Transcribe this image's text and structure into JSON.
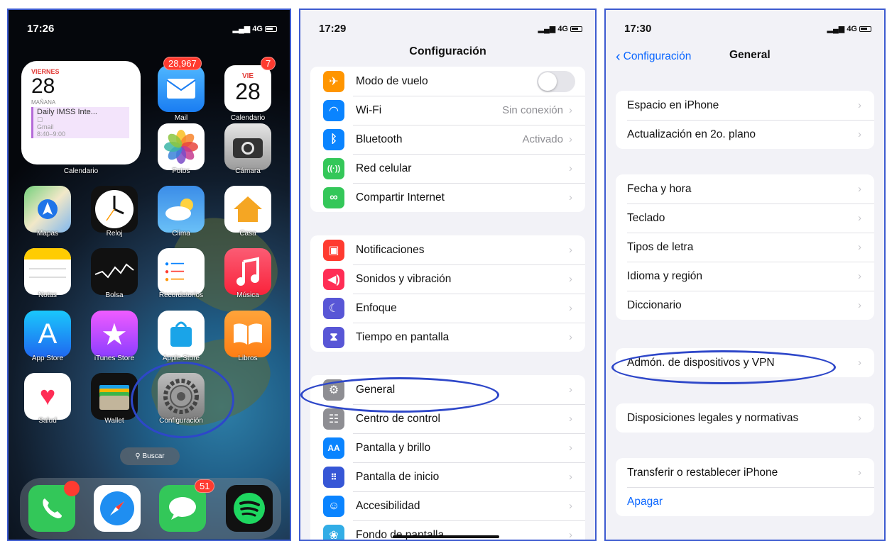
{
  "home": {
    "time": "17:26",
    "signal": "4G",
    "widget": {
      "weekday": "VIERNES",
      "day": "28",
      "tomorrow": "MAÑANA",
      "event_title": "Daily IMSS Inte...",
      "event_source": "Gmail",
      "event_time": "8:40–9:00",
      "label": "Calendario"
    },
    "apps": [
      {
        "label": "Mail",
        "badge": "28,967",
        "icon": "mail-icon"
      },
      {
        "label": "Calendario",
        "weekday": "VIE",
        "day": "28",
        "badge": "7",
        "icon": "calendar-icon"
      },
      {
        "label": "Fotos",
        "icon": "photos-icon"
      },
      {
        "label": "Cámara",
        "icon": "camera-icon"
      },
      {
        "label": "Mapas",
        "icon": "maps-icon"
      },
      {
        "label": "Reloj",
        "icon": "clock-icon"
      },
      {
        "label": "Clima",
        "icon": "weather-icon"
      },
      {
        "label": "Casa",
        "icon": "home-icon"
      },
      {
        "label": "Notas",
        "icon": "notes-icon"
      },
      {
        "label": "Bolsa",
        "icon": "stocks-icon"
      },
      {
        "label": "Recordatorios",
        "icon": "reminders-icon"
      },
      {
        "label": "Música",
        "icon": "music-icon"
      },
      {
        "label": "App Store",
        "icon": "app-store-icon"
      },
      {
        "label": "iTunes Store",
        "icon": "itunes-icon"
      },
      {
        "label": "Apple Store",
        "icon": "apple-store-icon"
      },
      {
        "label": "Libros",
        "icon": "books-icon"
      },
      {
        "label": "Salud",
        "icon": "health-icon"
      },
      {
        "label": "Wallet",
        "icon": "wallet-icon"
      },
      {
        "label": "Configuración",
        "icon": "settings-gear-icon"
      }
    ],
    "search_label": "Buscar",
    "dock_badge_messages": "51"
  },
  "settings": {
    "time": "17:29",
    "signal": "4G",
    "title": "Configuración",
    "groups": [
      [
        {
          "label": "Modo de vuelo",
          "color": "#ff9500",
          "toggle": true
        },
        {
          "label": "Wi-Fi",
          "value": "Sin conexión",
          "color": "#0a84ff"
        },
        {
          "label": "Bluetooth",
          "value": "Activado",
          "color": "#0a84ff"
        },
        {
          "label": "Red celular",
          "color": "#34c759"
        },
        {
          "label": "Compartir Internet",
          "color": "#34c759"
        }
      ],
      [
        {
          "label": "Notificaciones",
          "color": "#ff3b30"
        },
        {
          "label": "Sonidos y vibración",
          "color": "#ff2d55"
        },
        {
          "label": "Enfoque",
          "color": "#5856d6"
        },
        {
          "label": "Tiempo en pantalla",
          "color": "#5856d6"
        }
      ],
      [
        {
          "label": "General",
          "color": "#8e8e93"
        },
        {
          "label": "Centro de control",
          "color": "#8e8e93"
        },
        {
          "label": "Pantalla y brillo",
          "color": "#0a84ff"
        },
        {
          "label": "Pantalla de inicio",
          "color": "#3656d6"
        },
        {
          "label": "Accesibilidad",
          "color": "#0a84ff"
        },
        {
          "label": "Fondo de pantalla",
          "color": "#32ade6"
        }
      ]
    ]
  },
  "general": {
    "time": "17:30",
    "signal": "4G",
    "back_label": "Configuración",
    "title": "General",
    "groups": [
      [
        "Espacio en iPhone",
        "Actualización en 2o. plano"
      ],
      [
        "Fecha y hora",
        "Teclado",
        "Tipos de letra",
        "Idioma y región",
        "Diccionario"
      ],
      [
        "Admón. de dispositivos y VPN"
      ],
      [
        "Disposiciones legales y normativas"
      ],
      [
        "Transferir o restablecer iPhone"
      ]
    ],
    "shutdown_label": "Apagar"
  }
}
